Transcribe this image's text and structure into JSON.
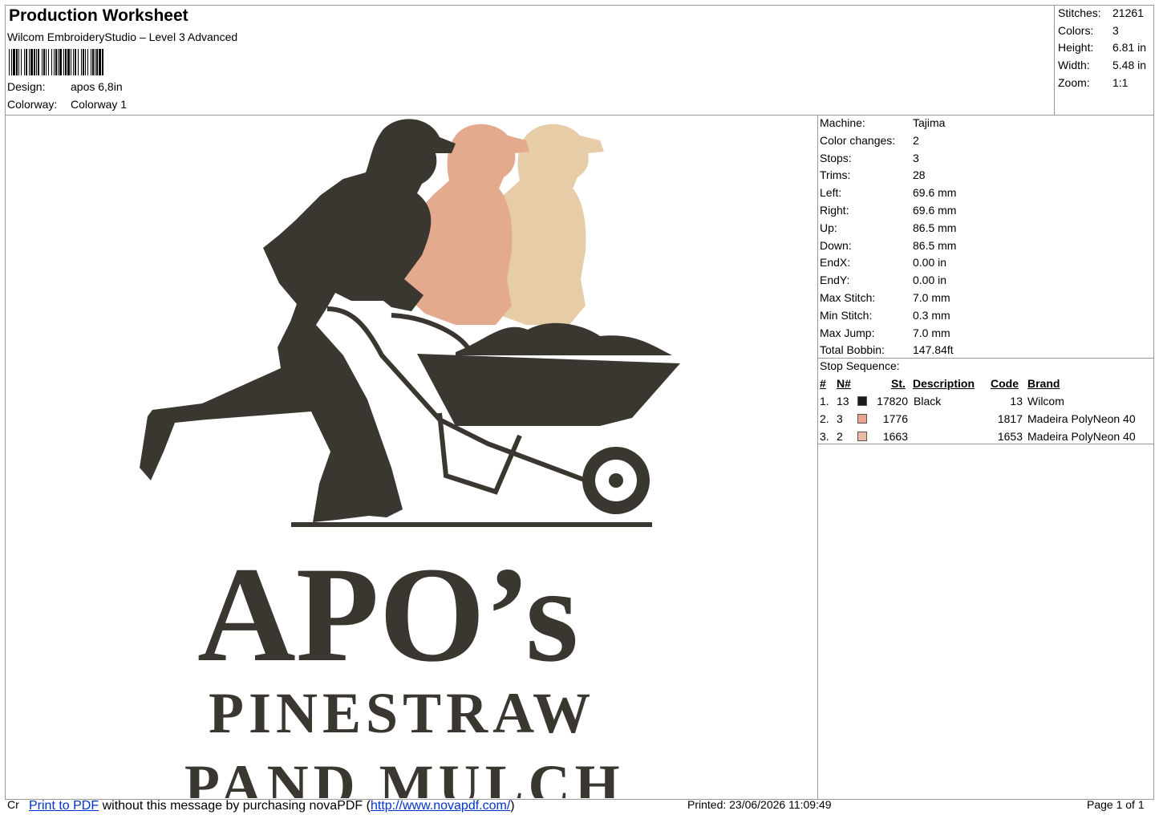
{
  "header": {
    "title": "Production Worksheet",
    "software": "Wilcom EmbroideryStudio – Level 3 Advanced",
    "design_label": "Design:",
    "design_value": "apos 6,8in",
    "colorway_label": "Colorway:",
    "colorway_value": "Colorway 1"
  },
  "summary": {
    "stitches_label": "Stitches:",
    "stitches": "21261",
    "colors_label": "Colors:",
    "colors": "3",
    "height_label": "Height:",
    "height": "6.81 in",
    "width_label": "Width:",
    "width": "5.48 in",
    "zoom_label": "Zoom:",
    "zoom": "1:1"
  },
  "specs": [
    {
      "label": "Machine:",
      "value": "Tajima"
    },
    {
      "label": "Color changes:",
      "value": "2"
    },
    {
      "label": "Stops:",
      "value": "3"
    },
    {
      "label": "Trims:",
      "value": "28"
    },
    {
      "label": "Left:",
      "value": "69.6 mm"
    },
    {
      "label": "Right:",
      "value": "69.6 mm"
    },
    {
      "label": "Up:",
      "value": "86.5 mm"
    },
    {
      "label": "Down:",
      "value": "86.5 mm"
    },
    {
      "label": "EndX:",
      "value": "0.00 in"
    },
    {
      "label": "EndY:",
      "value": "0.00 in"
    },
    {
      "label": "Max Stitch:",
      "value": "7.0 mm"
    },
    {
      "label": "Min Stitch:",
      "value": "0.3 mm"
    },
    {
      "label": "Max Jump:",
      "value": "7.0 mm"
    },
    {
      "label": "Total Bobbin:",
      "value": "147.84ft"
    }
  ],
  "stop_sequence": {
    "title": "Stop Sequence:",
    "columns": [
      "#",
      "N#",
      "St.",
      "Description",
      "Code",
      "Brand"
    ],
    "rows": [
      {
        "num": "1.",
        "n": "13",
        "color": "#1c1a18",
        "st": "17820",
        "desc": "Black",
        "code": "13",
        "brand": "Wilcom"
      },
      {
        "num": "2.",
        "n": "3",
        "color": "#e9a48f",
        "st": "1776",
        "desc": "",
        "code": "1817",
        "brand": "Madeira PolyNeon 40"
      },
      {
        "num": "3.",
        "n": "2",
        "color": "#eab9a4",
        "st": "1663",
        "desc": "",
        "code": "1653",
        "brand": "Madeira PolyNeon 40"
      }
    ]
  },
  "design_text": {
    "line1": "APO’s",
    "line2": "PINESTRAW",
    "line3": "PAND MULCH"
  },
  "colors": {
    "thread_dark": "#3a3630",
    "thread_peach": "#e3aa8e",
    "thread_tan": "#e6cda7"
  },
  "footer": {
    "left": "Cr",
    "link1": "Print to PDF",
    "middle": " without this message by purchasing novaPDF (",
    "link2": "http://www.novapdf.com/",
    "close": ")",
    "printed": "Printed: 23/06/2026 11:09:49",
    "page": "Page 1 of 1"
  }
}
